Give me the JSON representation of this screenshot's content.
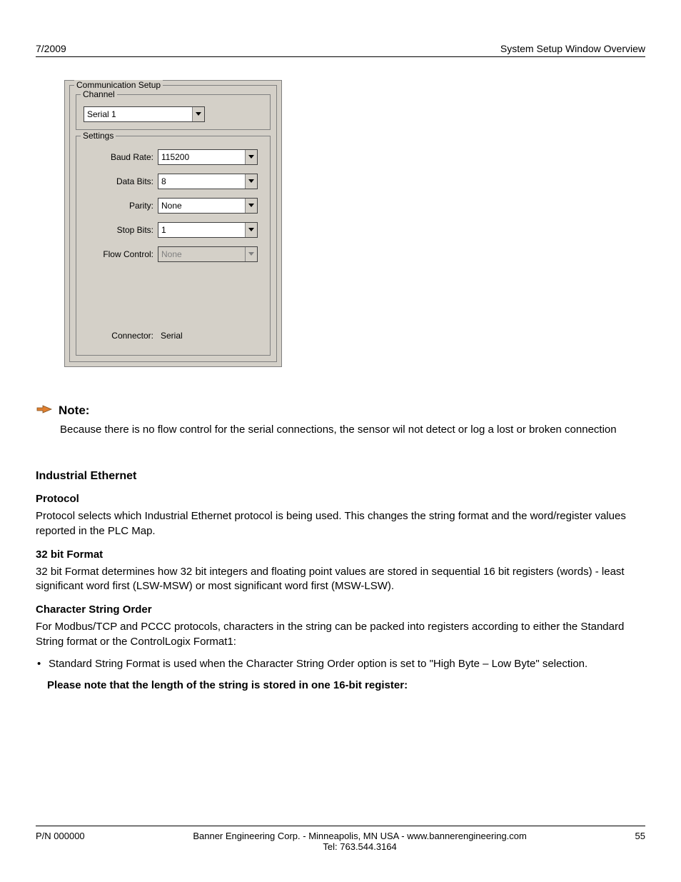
{
  "header": {
    "left": "7/2009",
    "right": "System Setup Window Overview"
  },
  "dialog": {
    "title": "Communication Setup",
    "channel": {
      "legend": "Channel",
      "value": "Serial 1"
    },
    "settings": {
      "legend": "Settings",
      "baud_label": "Baud Rate:",
      "baud_value": "115200",
      "databits_label": "Data Bits:",
      "databits_value": "8",
      "parity_label": "Parity:",
      "parity_value": "None",
      "stopbits_label": "Stop Bits:",
      "stopbits_value": "1",
      "flow_label": "Flow Control:",
      "flow_value": "None",
      "connector_label": "Connector:",
      "connector_value": "Serial"
    }
  },
  "note": {
    "title": "Note:",
    "body": "Because there is no flow control for the serial connections, the sensor wil not detect or log a lost or broken connection"
  },
  "section": {
    "h2": "Industrial Ethernet",
    "protocol_h": "Protocol",
    "protocol_p": "Protocol selects which Industrial Ethernet protocol is being used. This changes the string format and the word/register values reported in the PLC Map.",
    "format_h": "32 bit Format",
    "format_p": "32 bit Format determines how 32 bit integers and floating point values are stored in sequential 16 bit registers (words) - least significant word first (LSW-MSW) or most significant word first (MSW-LSW).",
    "cso_h": "Character String Order",
    "cso_p": "For Modbus/TCP and PCCC protocols, characters in the string can be packed into registers according to either the Standard String format or the ControlLogix Format1:",
    "bullet": "Standard String Format is used when the Character String Order option is set to \"High Byte – Low Byte\" selection.",
    "bold": "Please note that the length of the string is stored in one 16-bit register:"
  },
  "footer": {
    "left": "P/N 000000",
    "center1": "Banner Engineering Corp. - Minneapolis, MN USA - www.bannerengineering.com",
    "center2": "Tel: 763.544.3164",
    "right": "55"
  }
}
